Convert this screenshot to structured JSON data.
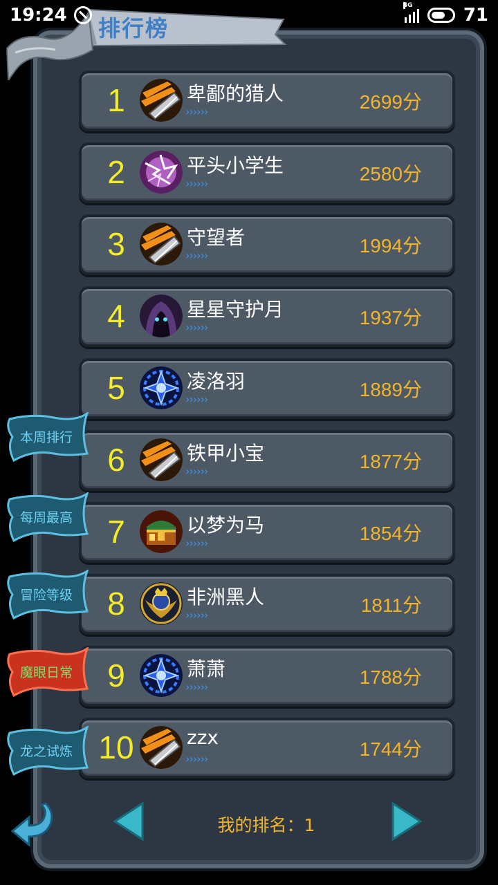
{
  "status_bar": {
    "time": "19:24",
    "network": "4G",
    "battery": "71"
  },
  "title": "排行榜",
  "ranks": [
    {
      "rank": "1",
      "name": "卑鄙的猎人",
      "score": "2699分",
      "avatar": "blade-icon",
      "chevrons": "››››››"
    },
    {
      "rank": "2",
      "name": "平头小学生",
      "score": "2580分",
      "avatar": "lightning-icon",
      "chevrons": "››››››"
    },
    {
      "rank": "3",
      "name": "守望者",
      "score": "1994分",
      "avatar": "blade-icon",
      "chevrons": "››››››"
    },
    {
      "rank": "4",
      "name": "星星守护月",
      "score": "1937分",
      "avatar": "hooded-figure-icon",
      "chevrons": "››››››"
    },
    {
      "rank": "5",
      "name": "凌洛羽",
      "score": "1889分",
      "avatar": "blue-rune-icon",
      "chevrons": "››››››"
    },
    {
      "rank": "6",
      "name": "铁甲小宝",
      "score": "1877分",
      "avatar": "blade-icon",
      "chevrons": "››››››"
    },
    {
      "rank": "7",
      "name": "以梦为马",
      "score": "1854分",
      "avatar": "treasure-chest-icon",
      "chevrons": "››››››"
    },
    {
      "rank": "8",
      "name": "非洲黑人",
      "score": "1811分",
      "avatar": "crown-emblem-icon",
      "chevrons": "››››››"
    },
    {
      "rank": "9",
      "name": "萧萧",
      "score": "1788分",
      "avatar": "blue-rune-icon",
      "chevrons": "››››››"
    },
    {
      "rank": "10",
      "name": "zzx",
      "score": "1744分",
      "avatar": "blade-icon",
      "chevrons": "››››››"
    }
  ],
  "side_tabs": [
    {
      "label": "本周排行",
      "active": false
    },
    {
      "label": "每周最高",
      "active": false
    },
    {
      "label": "冒险等级",
      "active": false
    },
    {
      "label": "魔眼日常",
      "active": true
    },
    {
      "label": "龙之试炼",
      "active": false
    }
  ],
  "footer": {
    "my_rank": "我的排名：1"
  },
  "colors": {
    "rank_number": "#f4ec28",
    "score": "#f2b52a",
    "chevron": "#3e95e6",
    "active_tab": "#c8321e",
    "tab": "#2a6f86"
  }
}
